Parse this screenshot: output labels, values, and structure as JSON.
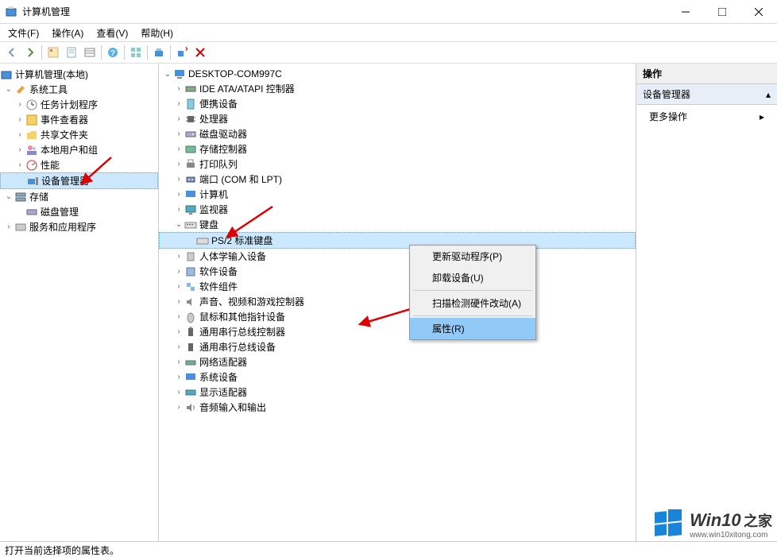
{
  "title": "计算机管理",
  "menus": {
    "file": "文件(F)",
    "action": "操作(A)",
    "view": "查看(V)",
    "help": "帮助(H)"
  },
  "left_tree": {
    "root": "计算机管理(本地)",
    "system_tools": "系统工具",
    "task_scheduler": "任务计划程序",
    "event_viewer": "事件查看器",
    "shared_folders": "共享文件夹",
    "local_users": "本地用户和组",
    "performance": "性能",
    "device_manager": "设备管理器",
    "storage": "存储",
    "disk_mgmt": "磁盘管理",
    "services_apps": "服务和应用程序"
  },
  "device_tree": {
    "root": "DESKTOP-COM997C",
    "ide": "IDE ATA/ATAPI 控制器",
    "portable": "便携设备",
    "processors": "处理器",
    "disk_drives": "磁盘驱动器",
    "storage_ctrl": "存储控制器",
    "print_queues": "打印队列",
    "ports": "端口 (COM 和 LPT)",
    "computer": "计算机",
    "monitors": "监视器",
    "keyboards": "键盘",
    "ps2_kb": "PS/2 标准键盘",
    "hid": "人体学输入设备",
    "software_dev": "软件设备",
    "software_comp": "软件组件",
    "sound": "声音、视频和游戏控制器",
    "mouse": "鼠标和其他指针设备",
    "usb_ctrl": "通用串行总线控制器",
    "usb_dev": "通用串行总线设备",
    "network": "网络适配器",
    "system_dev": "系统设备",
    "display": "显示适配器",
    "audio_io": "音频输入和输出"
  },
  "context_menu": {
    "update_driver": "更新驱动程序(P)",
    "uninstall": "卸载设备(U)",
    "scan": "扫描检测硬件改动(A)",
    "properties": "属性(R)"
  },
  "actions_panel": {
    "header": "操作",
    "section": "设备管理器",
    "more": "更多操作"
  },
  "statusbar": "打开当前选择项的属性表。",
  "watermark": {
    "brand": "Win10",
    "suffix": "之家",
    "url": "www.win10xitong.com"
  }
}
